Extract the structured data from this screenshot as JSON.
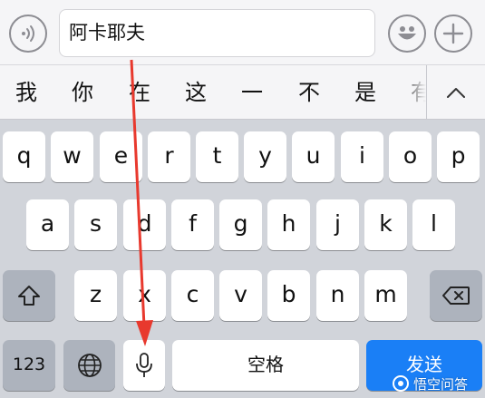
{
  "input_bar": {
    "text_value": "阿卡耶夫"
  },
  "candidates": {
    "items": [
      "我",
      "你",
      "在",
      "这",
      "一",
      "不",
      "是",
      "有"
    ]
  },
  "keyboard": {
    "row1": [
      "q",
      "w",
      "e",
      "r",
      "t",
      "y",
      "u",
      "i",
      "o",
      "p"
    ],
    "row2": [
      "a",
      "s",
      "d",
      "f",
      "g",
      "h",
      "j",
      "k",
      "l"
    ],
    "row3": [
      "z",
      "x",
      "c",
      "v",
      "b",
      "n",
      "m"
    ],
    "numbers_label": "123",
    "space_label": "空格",
    "send_label": "发送"
  },
  "watermark": {
    "text": "悟空问答"
  },
  "colors": {
    "keyboard_bg": "#d1d4da",
    "key_bg": "#ffffff",
    "function_key_bg": "#adb3bd",
    "send_key_bg": "#1a7ff6",
    "arrow_color": "#e8392e"
  },
  "icons": {
    "voice_input": "voice-wave-icon",
    "emoji": "emoji-icon",
    "plus": "plus-icon",
    "collapse": "chevron-up-icon",
    "shift": "shift-icon",
    "delete": "delete-icon",
    "globe": "globe-icon",
    "microphone": "microphone-icon"
  }
}
